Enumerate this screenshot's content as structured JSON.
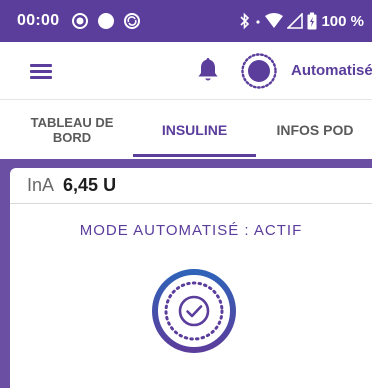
{
  "status_bar": {
    "time": "00:00",
    "battery": "100 %",
    "icons": [
      "record-icon",
      "circle-icon",
      "sync-icon",
      "bluetooth-icon",
      "wifi-icon",
      "signal-icon",
      "battery-icon"
    ]
  },
  "app_bar": {
    "mode_label": "Automatisé",
    "icons": [
      "menu-icon",
      "bell-icon",
      "automated-mode-icon"
    ]
  },
  "tabs": [
    {
      "label": "TABLEAU DE BORD",
      "active": false
    },
    {
      "label": "INSULINE",
      "active": true
    },
    {
      "label": "INFOS POD",
      "active": false
    }
  ],
  "insulin": {
    "ina_label": "InA",
    "ina_value": "6,45 U",
    "mode_status": "MODE AUTOMATISÉ : ACTIF"
  },
  "colors": {
    "brand": "#5b3d9c",
    "content_background": "#6a4fa3"
  }
}
